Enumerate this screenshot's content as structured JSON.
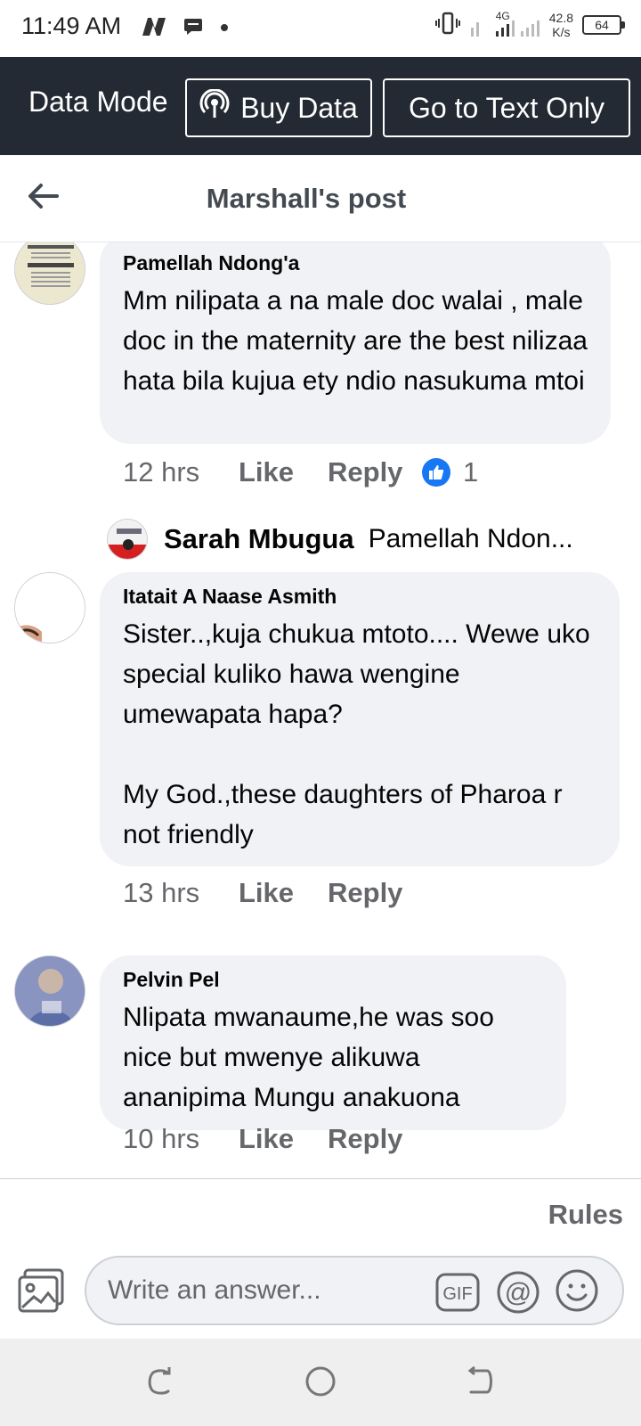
{
  "status_bar": {
    "time": "11:49 AM",
    "network_type": "4G",
    "net_speed_value": "42.8",
    "net_speed_unit": "K/s",
    "battery": "64",
    "icons": [
      "n-logo-icon",
      "message-icon",
      "dot-icon",
      "vibrate-icon",
      "signal-icon"
    ]
  },
  "data_bar": {
    "mode_label": "Data Mode",
    "buy_label": "Buy Data",
    "text_only_label": "Go to Text Only"
  },
  "header": {
    "title": "Marshall's post"
  },
  "comments": [
    {
      "author": "Pamellah Ndong'a",
      "text": "Mm nilipata a na male doc walai , male doc in the maternity are the best nilizaa hata bila kujua ety ndio nasukuma mtoi",
      "time": "12 hrs",
      "like_label": "Like",
      "reply_label": "Reply",
      "reaction_count": "1"
    },
    {
      "author": "Itatait A Naase Asmith",
      "text": "Sister..,kuja chukua mtoto.... Wewe uko special kuliko hawa wengine umewapata hapa?\n\nMy God.,these daughters of Pharoa r not friendly",
      "time": "13 hrs",
      "like_label": "Like",
      "reply_label": "Reply"
    },
    {
      "author": "Pelvin Pel",
      "text": "Nlipata mwanaume,he was soo nice but mwenye alikuwa ananipima Mungu anakuona",
      "time": "10 hrs",
      "like_label": "Like",
      "reply_label": "Reply"
    }
  ],
  "reply_preview": {
    "author": "Sarah Mbugua",
    "text": "Pamellah Ndon..."
  },
  "composer": {
    "rules_label": "Rules",
    "placeholder": "Write an answer...",
    "gif_label": "GIF",
    "mention_label": "@"
  },
  "colors": {
    "data_bar_bg": "#242a33",
    "bubble_bg": "#f0f2f5",
    "like_blue": "#1877f2",
    "meta_gray": "#65676b"
  }
}
